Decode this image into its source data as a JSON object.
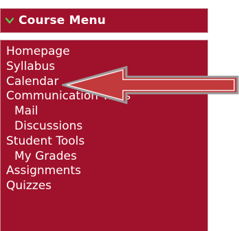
{
  "menu": {
    "title": "Course Menu",
    "items": [
      {
        "label": "Homepage",
        "level": 0
      },
      {
        "label": "Syllabus",
        "level": 0
      },
      {
        "label": "Calendar",
        "level": 0
      },
      {
        "label": "Communication Tools",
        "level": 0
      },
      {
        "label": "Mail",
        "level": 1
      },
      {
        "label": "Discussions",
        "level": 1
      },
      {
        "label": "Student Tools",
        "level": 0
      },
      {
        "label": "My Grades",
        "level": 1
      },
      {
        "label": "Assignments",
        "level": 0
      },
      {
        "label": "Quizzes",
        "level": 0
      }
    ]
  },
  "icons": {
    "header_icon": "chevron-down-icon",
    "pointer": "arrow-left-icon"
  },
  "colors": {
    "menu_background": "#a0112b",
    "menu_text": "#ffffff",
    "chevron": "#55cc55",
    "arrow_fill": "#c23a3c",
    "arrow_outline": "#9a9a9a"
  }
}
